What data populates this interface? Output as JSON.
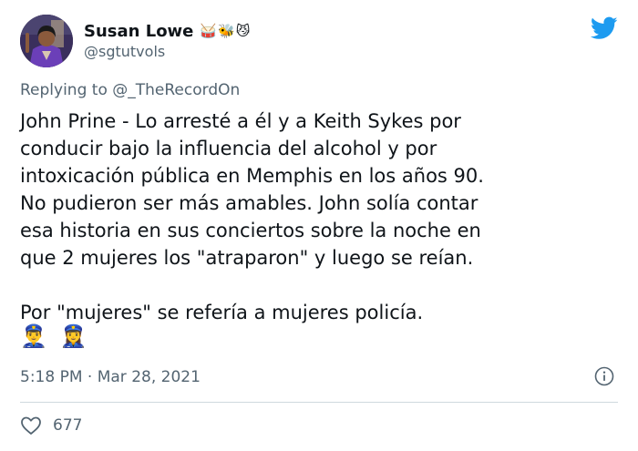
{
  "author": {
    "display_name": "Susan Lowe",
    "emojis": "🥁🐝😼",
    "handle": "@sgtutvols"
  },
  "reply": {
    "prefix": "Replying to ",
    "mention": "@_TheRecordOn"
  },
  "tweet": {
    "lines": [
      "John Prine - Lo arresté a él y a Keith Sykes por",
      "conducir bajo la influencia del alcohol y por",
      "intoxicación pública en Memphis en los años 90.",
      "No pudieron ser más amables. John solía contar",
      "esa historia en sus conciertos sobre la noche en",
      "que 2 mujeres los \"atraparon\" y luego se reían."
    ],
    "second_paragraph": "Por \"mujeres\" se refería a mujeres policía.",
    "emoji_line": "👮‍♂️👮‍♀️"
  },
  "meta": {
    "timestamp": "5:18 PM · Mar 28, 2021"
  },
  "engagement": {
    "likes": "677"
  },
  "colors": {
    "twitter_blue": "#1d9bf0",
    "secondary_text": "#536471",
    "divider": "#cfd9de"
  },
  "icons": [
    "avatar",
    "twitter-bird-icon",
    "info-icon",
    "heart-icon"
  ]
}
